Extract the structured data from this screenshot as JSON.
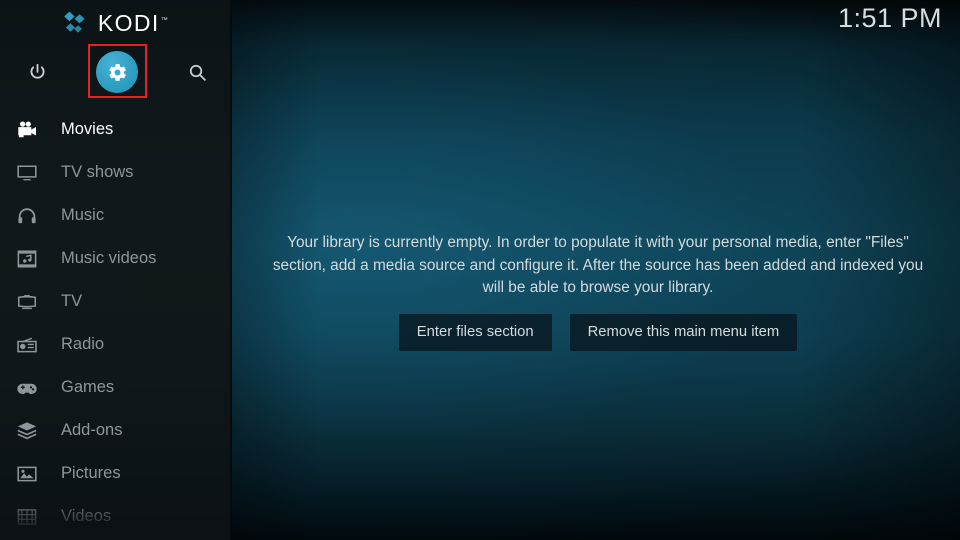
{
  "app": {
    "name": "Kodi",
    "logo_text": "KODI",
    "trademark": "™"
  },
  "header": {
    "clock": "1:51 PM",
    "icons": [
      {
        "name": "power-icon",
        "label": "Power"
      },
      {
        "name": "settings-gear-icon",
        "label": "Settings",
        "highlighted": true,
        "circle_color": "#2f9fc4"
      },
      {
        "name": "search-icon",
        "label": "Search"
      }
    ],
    "annotation_color": "#e8231f"
  },
  "sidebar": {
    "items": [
      {
        "label": "Movies",
        "icon": "movie-camera-icon",
        "state": "selected"
      },
      {
        "label": "TV shows",
        "icon": "television-icon",
        "state": "normal"
      },
      {
        "label": "Music",
        "icon": "headphones-icon",
        "state": "normal"
      },
      {
        "label": "Music videos",
        "icon": "music-film-icon",
        "state": "normal"
      },
      {
        "label": "TV",
        "icon": "tv-set-icon",
        "state": "normal"
      },
      {
        "label": "Radio",
        "icon": "radio-icon",
        "state": "normal"
      },
      {
        "label": "Games",
        "icon": "gamepad-icon",
        "state": "normal"
      },
      {
        "label": "Add-ons",
        "icon": "addon-box-icon",
        "state": "normal"
      },
      {
        "label": "Pictures",
        "icon": "picture-icon",
        "state": "normal"
      },
      {
        "label": "Videos",
        "icon": "film-strip-icon",
        "state": "dim"
      }
    ]
  },
  "main": {
    "empty_message": "Your library is currently empty. In order to populate it with your personal media, enter \"Files\" section, add a media source and configure it. After the source has been added and indexed you will be able to browse your library.",
    "buttons": [
      {
        "label": "Enter files section"
      },
      {
        "label": "Remove this main menu item"
      }
    ]
  },
  "colors": {
    "accent": "#2f9fc4",
    "sidebar_bg": "#10181b",
    "main_bg": "#0f4659",
    "text_primary": "#ffffff",
    "text_muted": "#8e9699"
  }
}
